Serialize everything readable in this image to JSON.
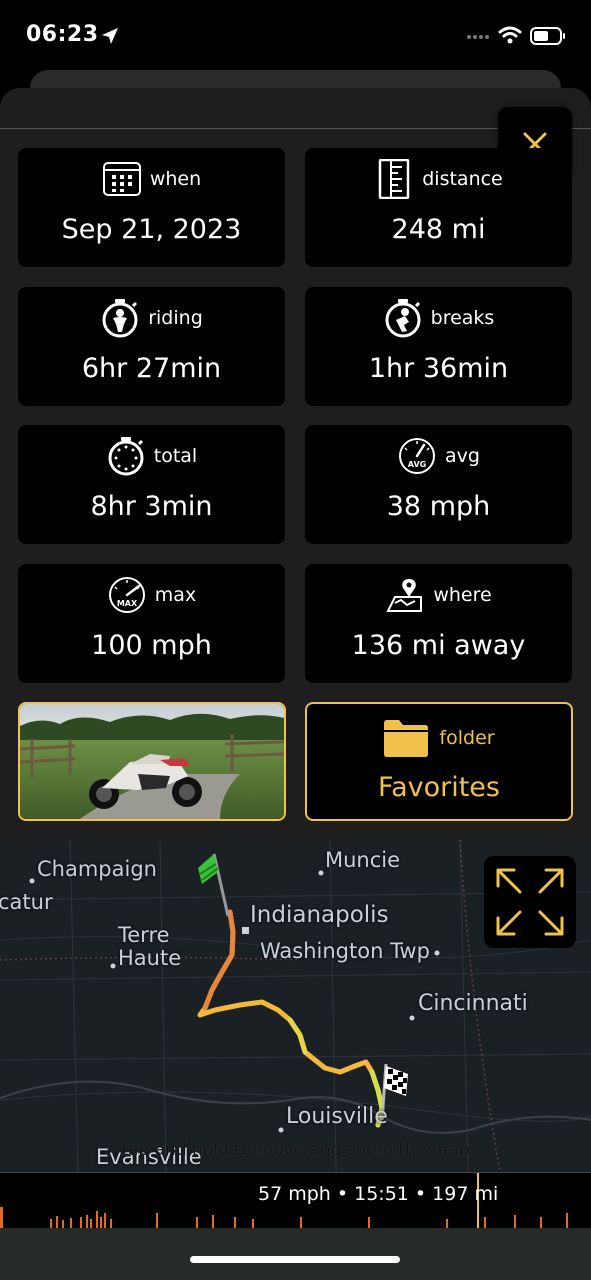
{
  "status_bar": {
    "time": "06:23",
    "icons": [
      "location-arrow-icon",
      "cellular-dots-icon",
      "wifi-icon",
      "battery-icon"
    ]
  },
  "close_button": {
    "icon": "close-icon",
    "color": "#f0c24a"
  },
  "stats": [
    {
      "icon": "calendar-icon",
      "label": "when",
      "value": "Sep 21, 2023"
    },
    {
      "icon": "ruler-icon",
      "label": "distance",
      "value": "248 mi"
    },
    {
      "icon": "stopwatch-rider-icon",
      "label": "riding",
      "value": "6hr 27min"
    },
    {
      "icon": "stopwatch-break-icon",
      "label": "breaks",
      "value": "1hr 36min"
    },
    {
      "icon": "stopwatch-icon",
      "label": "total",
      "value": "8hr 3min"
    },
    {
      "icon": "avg-gauge-icon",
      "label": "avg",
      "value": "38 mph",
      "gauge_text": "AVG"
    },
    {
      "icon": "max-gauge-icon",
      "label": "max",
      "value": "100 mph",
      "gauge_text": "MAX"
    },
    {
      "icon": "map-pin-icon",
      "label": "where",
      "value": "136 mi away"
    }
  ],
  "photo": {
    "description_name": "motorcycle-photo"
  },
  "folder": {
    "icon": "folder-icon",
    "label": "folder",
    "value": "Favorites",
    "accent": "#f0c24a"
  },
  "map": {
    "cities": [
      "Champaign",
      "Muncie",
      "catur",
      "Indianapolis",
      "Terre",
      "Haute",
      "Washington Twp",
      "Cincinnati",
      "Louisville",
      "Evansville"
    ],
    "hint": "tap and hold to move and zoom the map",
    "expand_icon": "expand-arrows-icon",
    "start_flag": "green-flag-icon",
    "finish_flag": "checkered-flag-icon"
  },
  "speed_bar": {
    "readout": "57 mph • 15:51 • 197 mi"
  },
  "colors": {
    "accent": "#f0c24a",
    "tile_bg": "#000000",
    "sheet_bg": "#1e1e1e"
  }
}
